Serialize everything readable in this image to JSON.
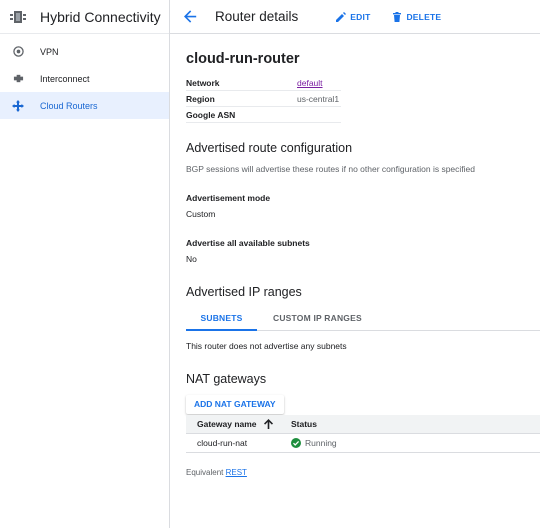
{
  "sidebar": {
    "title": "Hybrid Connectivity",
    "items": [
      {
        "label": "VPN",
        "icon": "vpn-icon"
      },
      {
        "label": "Interconnect",
        "icon": "interconnect-icon"
      },
      {
        "label": "Cloud Routers",
        "icon": "cloud-routers-icon",
        "active": true
      }
    ]
  },
  "topbar": {
    "title": "Router details",
    "edit_label": "EDIT",
    "delete_label": "DELETE"
  },
  "router": {
    "name": "cloud-run-router",
    "fields": [
      {
        "key": "Network",
        "value": "default"
      },
      {
        "key": "Region",
        "value": "us-central1"
      },
      {
        "key": "Google ASN",
        "value": ""
      }
    ]
  },
  "advertised_route": {
    "heading": "Advertised route configuration",
    "description": "BGP sessions will advertise these routes if no other configuration is specified",
    "mode_label": "Advertisement mode",
    "mode_value": "Custom",
    "subnets_label": "Advertise all available subnets",
    "subnets_value": "No"
  },
  "ip_ranges": {
    "heading": "Advertised IP ranges",
    "tabs": [
      "SUBNETS",
      "CUSTOM IP RANGES"
    ],
    "message": "This router does not advertise any subnets"
  },
  "nat": {
    "heading": "NAT gateways",
    "add_label": "ADD NAT GATEWAY",
    "columns": [
      "Gateway name",
      "Status"
    ],
    "rows": [
      {
        "name": "cloud-run-nat",
        "status": "Running"
      }
    ]
  },
  "footer": {
    "prefix": "Equivalent",
    "link": "REST"
  },
  "colors": {
    "accent": "#1a73e8",
    "success": "#1e8e3e",
    "visited_link": "#7b1fa2"
  }
}
